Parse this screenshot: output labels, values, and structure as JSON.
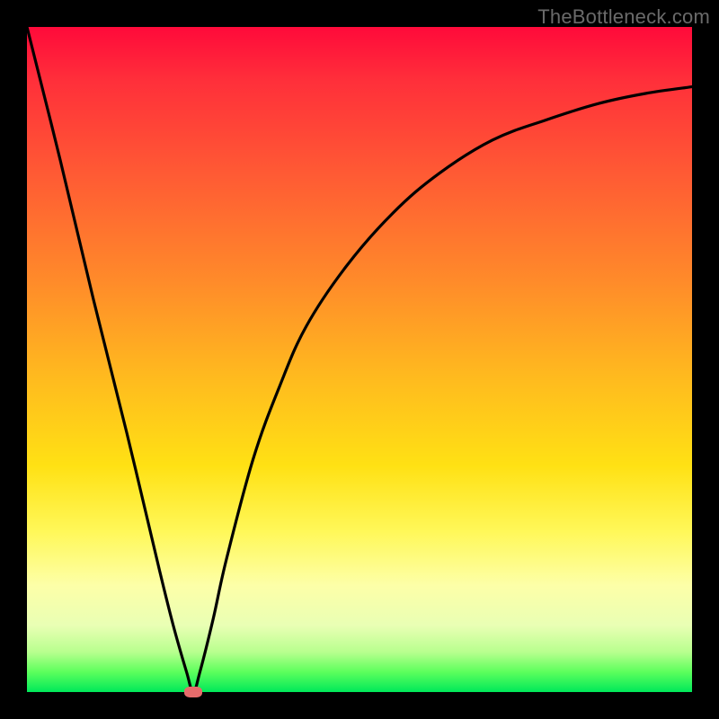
{
  "watermark": "TheBottleneck.com",
  "chart_data": {
    "type": "line",
    "title": "",
    "xlabel": "",
    "ylabel": "",
    "xlim": [
      0,
      100
    ],
    "ylim": [
      0,
      100
    ],
    "grid": false,
    "legend": false,
    "background_gradient": {
      "stops": [
        {
          "pct": 0,
          "color": "#ff0a3a"
        },
        {
          "pct": 22,
          "color": "#ff5a34"
        },
        {
          "pct": 52,
          "color": "#ffb81f"
        },
        {
          "pct": 76,
          "color": "#fff85a"
        },
        {
          "pct": 90,
          "color": "#e9ffb4"
        },
        {
          "pct": 100,
          "color": "#00e85a"
        }
      ]
    },
    "series": [
      {
        "name": "bottleneck-curve",
        "x": [
          0,
          5,
          10,
          15,
          20,
          22,
          24,
          25,
          26,
          28,
          30,
          34,
          38,
          42,
          48,
          55,
          62,
          70,
          78,
          86,
          93,
          100
        ],
        "y": [
          100,
          80,
          59,
          39,
          18,
          10,
          3,
          0,
          3,
          11,
          20,
          35,
          46,
          55,
          64,
          72,
          78,
          83,
          86,
          88.5,
          90,
          91
        ]
      }
    ],
    "min_marker": {
      "x": 25,
      "y": 0,
      "color": "#e66b6b"
    }
  }
}
